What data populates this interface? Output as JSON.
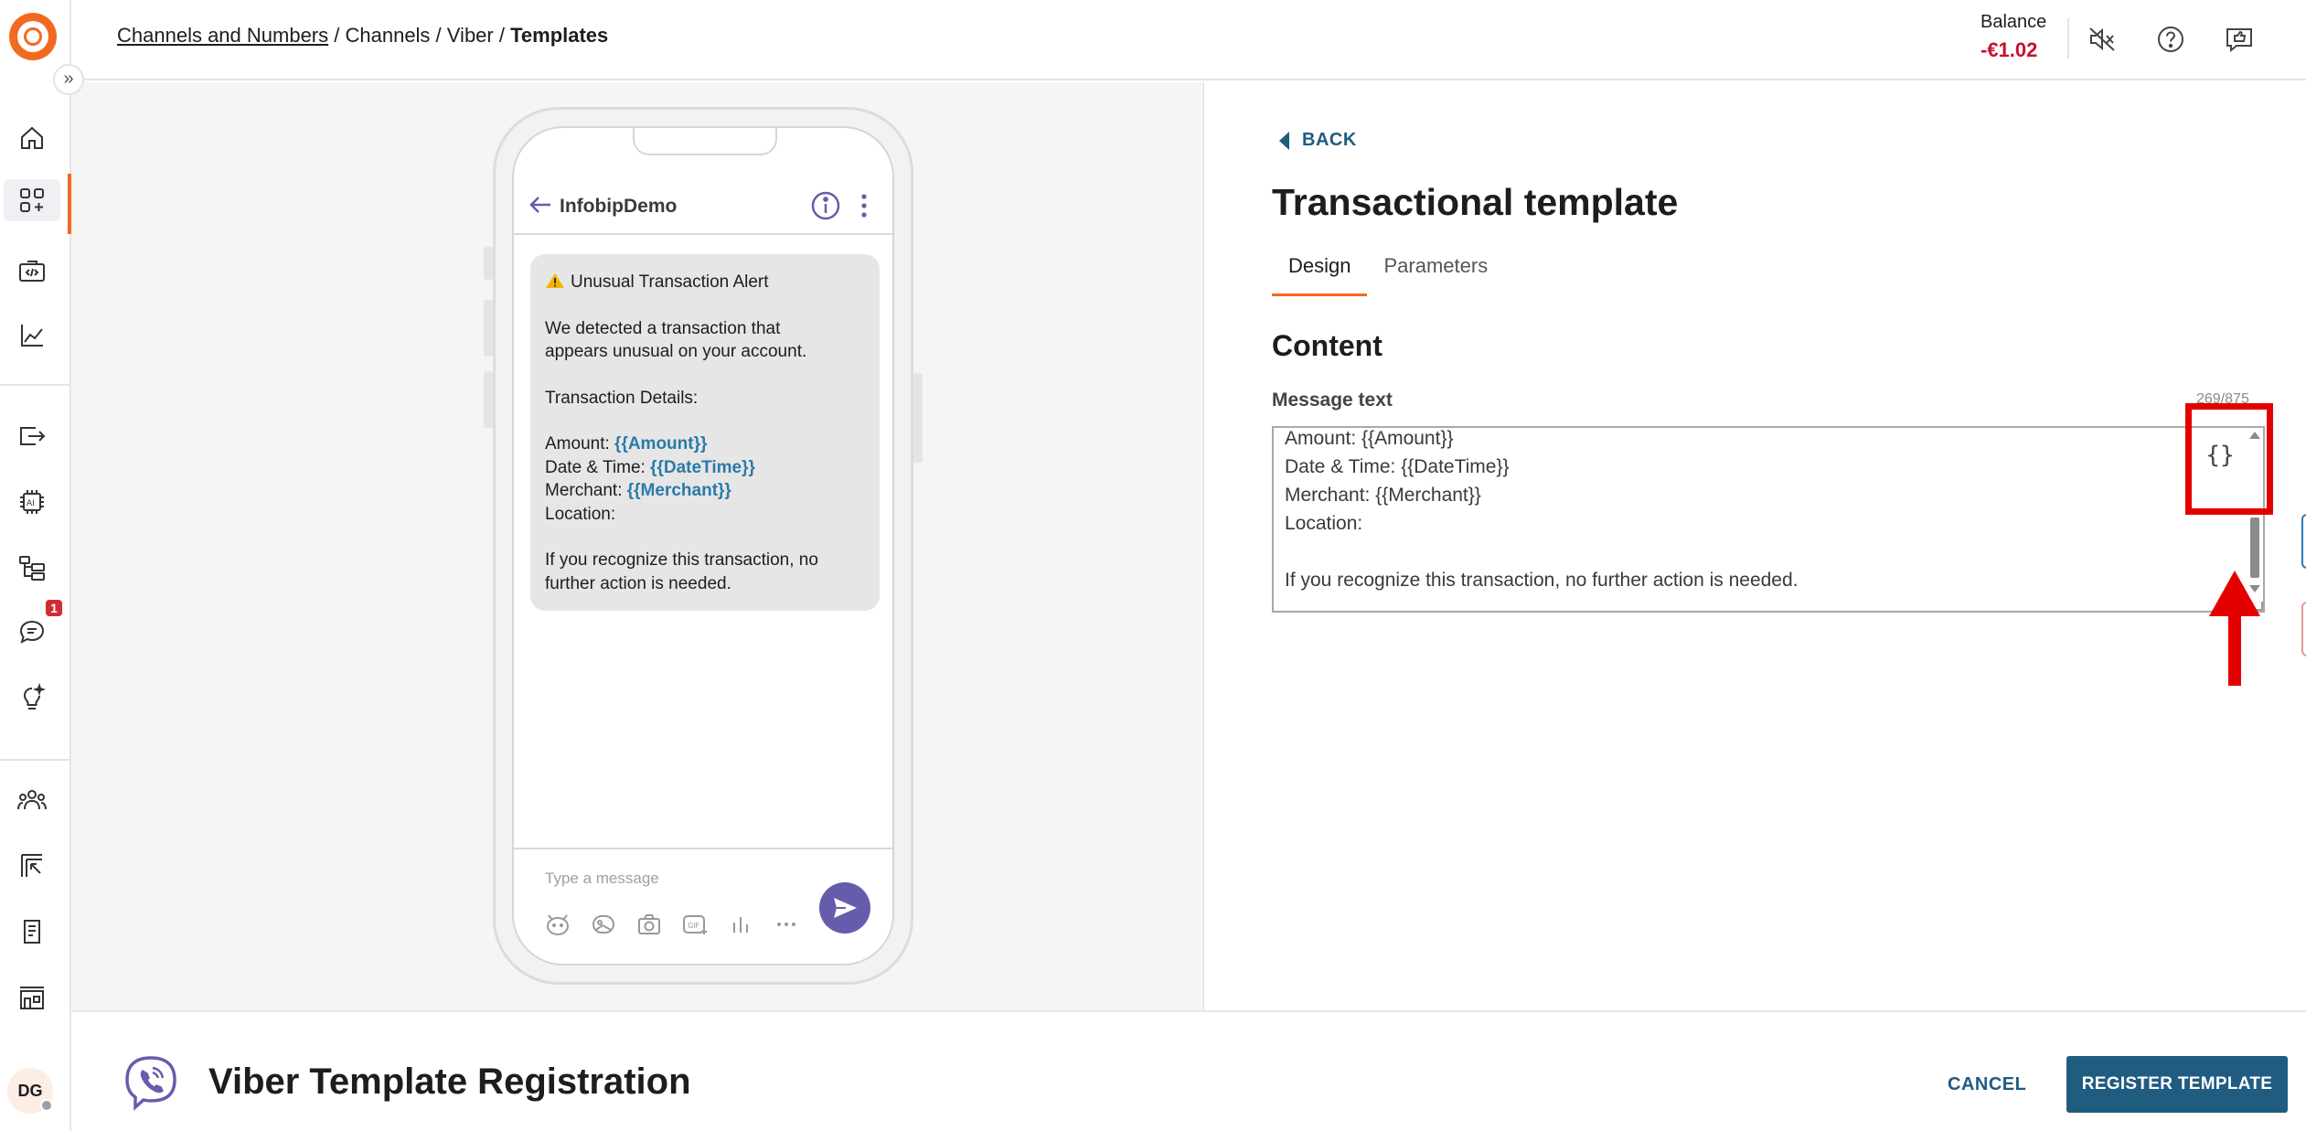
{
  "topbar": {
    "breadcrumb": {
      "link": "Channels and Numbers",
      "sep1": " / ",
      "item2": "Channels",
      "sep2": " / ",
      "item3": "Viber",
      "sep3": " / ",
      "current": "Templates"
    },
    "balance_label": "Balance",
    "balance_value": "-€1.02",
    "icons": [
      "sound-off-icon",
      "help-icon",
      "feedback-icon"
    ]
  },
  "sidebar": {
    "icons": [
      "home-icon",
      "apps-icon",
      "developer-tools-icon",
      "analytics-icon",
      "export-icon",
      "ai-chip-icon",
      "flow-icon",
      "chat-icon",
      "ideas-icon",
      "people-icon",
      "campaigns-icon",
      "docs-icon",
      "marketplace-icon"
    ],
    "notification_count": "1",
    "avatar_initials": "DG"
  },
  "preview": {
    "chat_name": "InfobipDemo",
    "message": {
      "title": "Unusual Transaction Alert",
      "body_line1": "We detected a transaction that",
      "body_line2": "appears unusual on your account.",
      "details_label": "Transaction Details:",
      "amount_label": "Amount: ",
      "amount_var": "{{Amount}}",
      "datetime_label": "Date & Time: ",
      "datetime_var": "{{DateTime}}",
      "merchant_label": "Merchant: ",
      "merchant_var": "{{Merchant}}",
      "location_label": "Location:",
      "footer_line1": "If you recognize this transaction, no",
      "footer_line2": "further action is needed."
    },
    "compose_placeholder": "Type a message"
  },
  "panel": {
    "back_label": "BACK",
    "title": "Transactional template",
    "tabs": [
      {
        "label": "Design",
        "active": true
      },
      {
        "label": "Parameters",
        "active": false
      }
    ],
    "section_title": "Content",
    "message_label": "Message text",
    "char_count": "269/875",
    "textarea_lines": [
      "Amount: {{Amount}}",
      "Date & Time: {{DateTime}}",
      "Merchant: {{Merchant}}",
      "Location:",
      "",
      "If you recognize this transaction, no further action is needed."
    ],
    "variable_button": "{}"
  },
  "footer": {
    "title": "Viber Template Registration",
    "cancel_label": "CANCEL",
    "register_label": "REGISTER TEMPLATE"
  },
  "colors": {
    "brand_orange": "#f26a21",
    "primary_blue": "#1f5c80",
    "viber_purple": "#665cac",
    "balance_red": "#c8102e",
    "annotation_red": "#e50000"
  }
}
